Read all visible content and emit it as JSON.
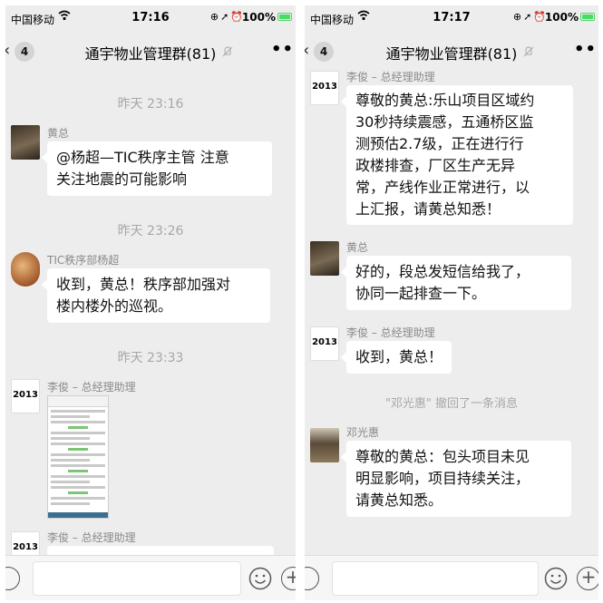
{
  "left": {
    "status": {
      "carrier": "中国移动",
      "time": "17:16",
      "battery": "100%"
    },
    "nav": {
      "unread": "4",
      "title": "通宇物业管理群(81)"
    },
    "messages": {
      "ts1": "昨天 23:16",
      "m1_sender": "黄总",
      "m1_line1": "@杨超—TIC秩序主管   注意",
      "m1_line2": "关注地震的可能影响",
      "ts2": "昨天 23:26",
      "m2_sender": "TIC秩序部杨超",
      "m2_line1": "收到，黄总！秩序部加强对",
      "m2_line2": "楼内楼外的巡视。",
      "ts3": "昨天 23:33",
      "m3_sender": "李俊 – 总经理助理",
      "m4_sender": "李俊 – 总经理助理"
    }
  },
  "right": {
    "status": {
      "carrier": "中国移动",
      "time": "17:17",
      "battery": "100%"
    },
    "nav": {
      "unread": "4",
      "title": "通宇物业管理群(81)"
    },
    "messages": {
      "m1_sender": "李俊 – 总经理助理",
      "m1_lines": [
        "尊敬的黄总:乐山项目区域约",
        "30秒持续震感，五通桥区监",
        "测预估2.7级，正在进行行",
        "政楼排查，厂区生产无异",
        "常，产线作业正常进行，以",
        "上汇报，请黄总知悉！"
      ],
      "m2_sender": "黄总",
      "m2_line1": "好的，段总发短信给我了，",
      "m2_line2": "协同一起排查一下。",
      "m3_sender": "李俊 – 总经理助理",
      "m3_text": "收到，黄总！",
      "recall": "\"邓光惠\" 撤回了一条消息",
      "m4_sender": "邓光惠",
      "m4_line1": "尊敬的黄总：包头项目未见",
      "m4_line2": "明显影响，项目持续关注，",
      "m4_line3": "请黄总知悉。"
    }
  },
  "avatar_labels": {
    "year": "2013"
  },
  "colors": {
    "chat_bg": "#ededed",
    "bubble": "#ffffff",
    "muted_text": "#a7a7a7",
    "battery": "#4cd964"
  },
  "icons": [
    "wifi-icon",
    "lock-rotation-icon",
    "location-icon",
    "alarm-icon",
    "battery-icon",
    "back-chevron-icon",
    "mute-icon",
    "more-icon",
    "voice-icon",
    "emoji-icon",
    "plus-icon"
  ]
}
